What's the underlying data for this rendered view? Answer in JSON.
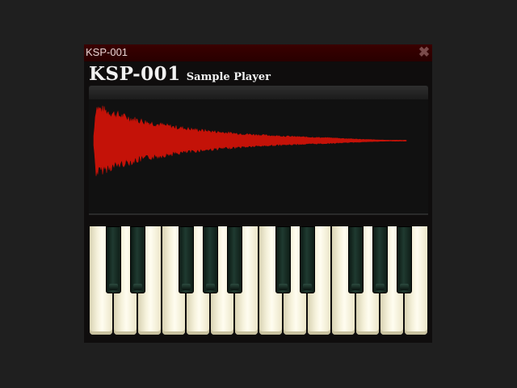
{
  "window": {
    "title": "KSP-001",
    "close_icon": "close-icon"
  },
  "header": {
    "name": "KSP-001",
    "subtitle": "Sample Player"
  },
  "waveform": {
    "color": "#c41208"
  },
  "keyboard": {
    "white_keys": 14,
    "black_keys": 10,
    "white_color": "#f6f2dc",
    "black_color": "#1f3a30"
  }
}
